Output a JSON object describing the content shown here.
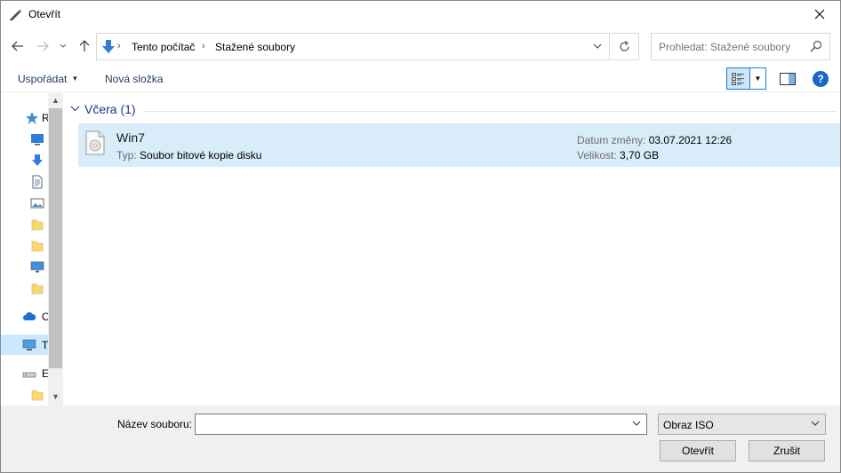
{
  "window": {
    "title": "Otevřít"
  },
  "nav": {
    "breadcrumbs": [
      "Tento počítač",
      "Stažené soubory"
    ],
    "search_placeholder": "Prohledat: Stažené soubory"
  },
  "toolbar": {
    "organize_label": "Uspořádat",
    "new_folder_label": "Nová složka",
    "help_label": "?"
  },
  "navpane": {
    "visible_letters": [
      "R",
      "O",
      "T",
      "E"
    ]
  },
  "content": {
    "group_header": "Včera (1)",
    "files": [
      {
        "name": "Win7",
        "type_label": "Typ:",
        "type_value": "Soubor bitové kopie disku",
        "date_label": "Datum změny:",
        "date_value": "03.07.2021 12:26",
        "size_label": "Velikost:",
        "size_value": "3,70 GB"
      }
    ]
  },
  "bottom": {
    "filename_label": "Název souboru:",
    "filename_value": "",
    "filter_value": "Obraz ISO",
    "open_label": "Otevřít",
    "cancel_label": "Zrušit"
  },
  "colors": {
    "accent_blue": "#1f7dd3",
    "selection": "#d9ecfa",
    "group_header": "#1e3287"
  }
}
